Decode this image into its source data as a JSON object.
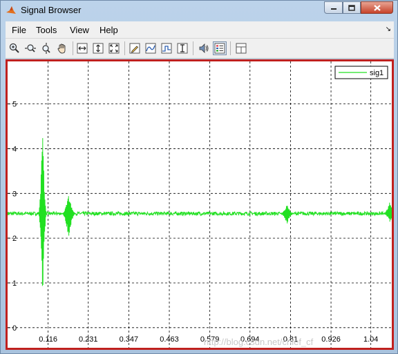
{
  "window": {
    "title": "Signal Browser"
  },
  "menu": {
    "file": "File",
    "tools": "Tools",
    "view": "View",
    "help": "Help"
  },
  "toolbar": {
    "icons": [
      "zoom-in-icon",
      "zoom-x-icon",
      "zoom-y-icon",
      "pan-hand-icon",
      "fit-x-icon",
      "fit-y-icon",
      "fit-all-icon",
      "edit-icon",
      "signal-icon",
      "step-icon",
      "marker-icon",
      "speaker-icon",
      "legend-icon",
      "layout-icon"
    ]
  },
  "colors": {
    "signal": "#22e022",
    "frame": "#c0201e"
  },
  "chart_data": {
    "type": "line",
    "grid": true,
    "legend": "top-right",
    "x_ticks": [
      "0.116",
      "0.231",
      "0.347",
      "0.463",
      "0.579",
      "0.694",
      "0.81",
      "0.926",
      "1.04"
    ],
    "y_ticks": [
      "0",
      "1",
      "2",
      "3",
      "4",
      "5"
    ],
    "xlim": [
      0,
      1.1
    ],
    "ylim": [
      -0.45,
      5.95
    ],
    "baseline": 2.55,
    "series": [
      {
        "name": "sig1",
        "events": [
          {
            "x": 0.1,
            "min": 0.35,
            "max": 4.6
          },
          {
            "x": 0.175,
            "min": 1.95,
            "max": 3.0
          },
          {
            "x": 0.8,
            "min": 2.3,
            "max": 2.75
          },
          {
            "x": 1.095,
            "min": 2.35,
            "max": 2.85
          }
        ]
      }
    ]
  },
  "watermark": "http://blog.csdn.net/chief_cf"
}
